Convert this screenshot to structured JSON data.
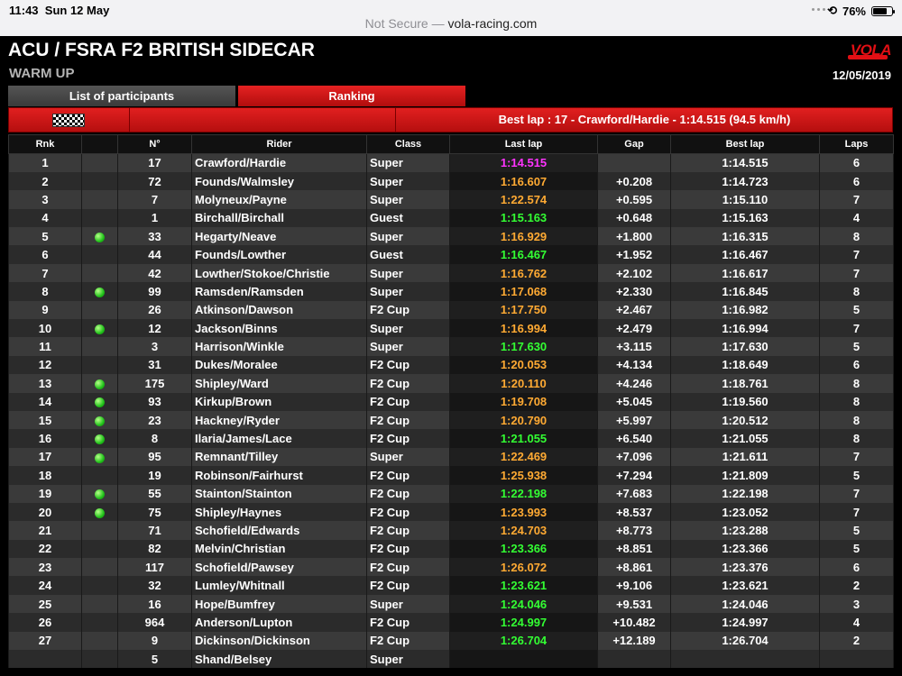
{
  "status": {
    "time": "11:43",
    "date": "Sun 12 May",
    "battery": "76%",
    "battery_level": 0.76
  },
  "address": {
    "secure_label": "Not Secure —",
    "url": "vola-racing.com"
  },
  "header": {
    "title": "ACU / FSRA F2 BRITISH SIDECAR",
    "session": "WARM UP",
    "date": "12/05/2019",
    "logo": "VOLA"
  },
  "tabs": {
    "participants": "List of participants",
    "ranking": "Ranking"
  },
  "best_lap": "Best lap : 17 - Crawford/Hardie - 1:14.515 (94.5 km/h)",
  "columns": [
    "Rnk",
    "",
    "N°",
    "Rider",
    "Class",
    "Last lap",
    "Gap",
    "Best lap",
    "Laps"
  ],
  "colors": {
    "personal_best": "#33ff33",
    "overall_best": "#ff33ff",
    "slower": "#ffaa33"
  },
  "rows": [
    {
      "rnk": "1",
      "pit": false,
      "no": "17",
      "rider": "Crawford/Hardie",
      "cls": "Super",
      "last": "1:14.515",
      "lc": "purple",
      "gap": "",
      "best": "1:14.515",
      "laps": "6"
    },
    {
      "rnk": "2",
      "pit": false,
      "no": "72",
      "rider": "Founds/Walmsley",
      "cls": "Super",
      "last": "1:16.607",
      "lc": "orange",
      "gap": "+0.208",
      "best": "1:14.723",
      "laps": "6"
    },
    {
      "rnk": "3",
      "pit": false,
      "no": "7",
      "rider": "Molyneux/Payne",
      "cls": "Super",
      "last": "1:22.574",
      "lc": "orange",
      "gap": "+0.595",
      "best": "1:15.110",
      "laps": "7"
    },
    {
      "rnk": "4",
      "pit": false,
      "no": "1",
      "rider": "Birchall/Birchall",
      "cls": "Guest",
      "last": "1:15.163",
      "lc": "green",
      "gap": "+0.648",
      "best": "1:15.163",
      "laps": "4"
    },
    {
      "rnk": "5",
      "pit": true,
      "no": "33",
      "rider": "Hegarty/Neave",
      "cls": "Super",
      "last": "1:16.929",
      "lc": "orange",
      "gap": "+1.800",
      "best": "1:16.315",
      "laps": "8"
    },
    {
      "rnk": "6",
      "pit": false,
      "no": "44",
      "rider": "Founds/Lowther",
      "cls": "Guest",
      "last": "1:16.467",
      "lc": "green",
      "gap": "+1.952",
      "best": "1:16.467",
      "laps": "7"
    },
    {
      "rnk": "7",
      "pit": false,
      "no": "42",
      "rider": "Lowther/Stokoe/Christie",
      "cls": "Super",
      "last": "1:16.762",
      "lc": "orange",
      "gap": "+2.102",
      "best": "1:16.617",
      "laps": "7"
    },
    {
      "rnk": "8",
      "pit": true,
      "no": "99",
      "rider": "Ramsden/Ramsden",
      "cls": "Super",
      "last": "1:17.068",
      "lc": "orange",
      "gap": "+2.330",
      "best": "1:16.845",
      "laps": "8"
    },
    {
      "rnk": "9",
      "pit": false,
      "no": "26",
      "rider": "Atkinson/Dawson",
      "cls": "F2 Cup",
      "last": "1:17.750",
      "lc": "orange",
      "gap": "+2.467",
      "best": "1:16.982",
      "laps": "5"
    },
    {
      "rnk": "10",
      "pit": true,
      "no": "12",
      "rider": "Jackson/Binns",
      "cls": "Super",
      "last": "1:16.994",
      "lc": "orange",
      "gap": "+2.479",
      "best": "1:16.994",
      "laps": "7"
    },
    {
      "rnk": "11",
      "pit": false,
      "no": "3",
      "rider": "Harrison/Winkle",
      "cls": "Super",
      "last": "1:17.630",
      "lc": "green",
      "gap": "+3.115",
      "best": "1:17.630",
      "laps": "5"
    },
    {
      "rnk": "12",
      "pit": false,
      "no": "31",
      "rider": "Dukes/Moralee",
      "cls": "F2 Cup",
      "last": "1:20.053",
      "lc": "orange",
      "gap": "+4.134",
      "best": "1:18.649",
      "laps": "6"
    },
    {
      "rnk": "13",
      "pit": true,
      "no": "175",
      "rider": "Shipley/Ward",
      "cls": "F2 Cup",
      "last": "1:20.110",
      "lc": "orange",
      "gap": "+4.246",
      "best": "1:18.761",
      "laps": "8"
    },
    {
      "rnk": "14",
      "pit": true,
      "no": "93",
      "rider": "Kirkup/Brown",
      "cls": "F2 Cup",
      "last": "1:19.708",
      "lc": "orange",
      "gap": "+5.045",
      "best": "1:19.560",
      "laps": "8"
    },
    {
      "rnk": "15",
      "pit": true,
      "no": "23",
      "rider": "Hackney/Ryder",
      "cls": "F2 Cup",
      "last": "1:20.790",
      "lc": "orange",
      "gap": "+5.997",
      "best": "1:20.512",
      "laps": "8"
    },
    {
      "rnk": "16",
      "pit": true,
      "no": "8",
      "rider": "Ilaria/James/Lace",
      "cls": "F2 Cup",
      "last": "1:21.055",
      "lc": "green",
      "gap": "+6.540",
      "best": "1:21.055",
      "laps": "8"
    },
    {
      "rnk": "17",
      "pit": true,
      "no": "95",
      "rider": "Remnant/Tilley",
      "cls": "Super",
      "last": "1:22.469",
      "lc": "orange",
      "gap": "+7.096",
      "best": "1:21.611",
      "laps": "7"
    },
    {
      "rnk": "18",
      "pit": false,
      "no": "19",
      "rider": "Robinson/Fairhurst",
      "cls": "F2 Cup",
      "last": "1:25.938",
      "lc": "orange",
      "gap": "+7.294",
      "best": "1:21.809",
      "laps": "5"
    },
    {
      "rnk": "19",
      "pit": true,
      "no": "55",
      "rider": "Stainton/Stainton",
      "cls": "F2 Cup",
      "last": "1:22.198",
      "lc": "green",
      "gap": "+7.683",
      "best": "1:22.198",
      "laps": "7"
    },
    {
      "rnk": "20",
      "pit": true,
      "no": "75",
      "rider": "Shipley/Haynes",
      "cls": "F2 Cup",
      "last": "1:23.993",
      "lc": "orange",
      "gap": "+8.537",
      "best": "1:23.052",
      "laps": "7"
    },
    {
      "rnk": "21",
      "pit": false,
      "no": "71",
      "rider": "Schofield/Edwards",
      "cls": "F2 Cup",
      "last": "1:24.703",
      "lc": "orange",
      "gap": "+8.773",
      "best": "1:23.288",
      "laps": "5"
    },
    {
      "rnk": "22",
      "pit": false,
      "no": "82",
      "rider": "Melvin/Christian",
      "cls": "F2 Cup",
      "last": "1:23.366",
      "lc": "green",
      "gap": "+8.851",
      "best": "1:23.366",
      "laps": "5"
    },
    {
      "rnk": "23",
      "pit": false,
      "no": "117",
      "rider": "Schofield/Pawsey",
      "cls": "F2 Cup",
      "last": "1:26.072",
      "lc": "orange",
      "gap": "+8.861",
      "best": "1:23.376",
      "laps": "6"
    },
    {
      "rnk": "24",
      "pit": false,
      "no": "32",
      "rider": "Lumley/Whitnall",
      "cls": "F2 Cup",
      "last": "1:23.621",
      "lc": "green",
      "gap": "+9.106",
      "best": "1:23.621",
      "laps": "2"
    },
    {
      "rnk": "25",
      "pit": false,
      "no": "16",
      "rider": "Hope/Bumfrey",
      "cls": "Super",
      "last": "1:24.046",
      "lc": "green",
      "gap": "+9.531",
      "best": "1:24.046",
      "laps": "3"
    },
    {
      "rnk": "26",
      "pit": false,
      "no": "964",
      "rider": "Anderson/Lupton",
      "cls": "F2 Cup",
      "last": "1:24.997",
      "lc": "green",
      "gap": "+10.482",
      "best": "1:24.997",
      "laps": "4"
    },
    {
      "rnk": "27",
      "pit": false,
      "no": "9",
      "rider": "Dickinson/Dickinson",
      "cls": "F2 Cup",
      "last": "1:26.704",
      "lc": "green",
      "gap": "+12.189",
      "best": "1:26.704",
      "laps": "2"
    },
    {
      "rnk": "",
      "pit": false,
      "no": "5",
      "rider": "Shand/Belsey",
      "cls": "Super",
      "last": "",
      "lc": "green",
      "gap": "",
      "best": "",
      "laps": ""
    }
  ]
}
